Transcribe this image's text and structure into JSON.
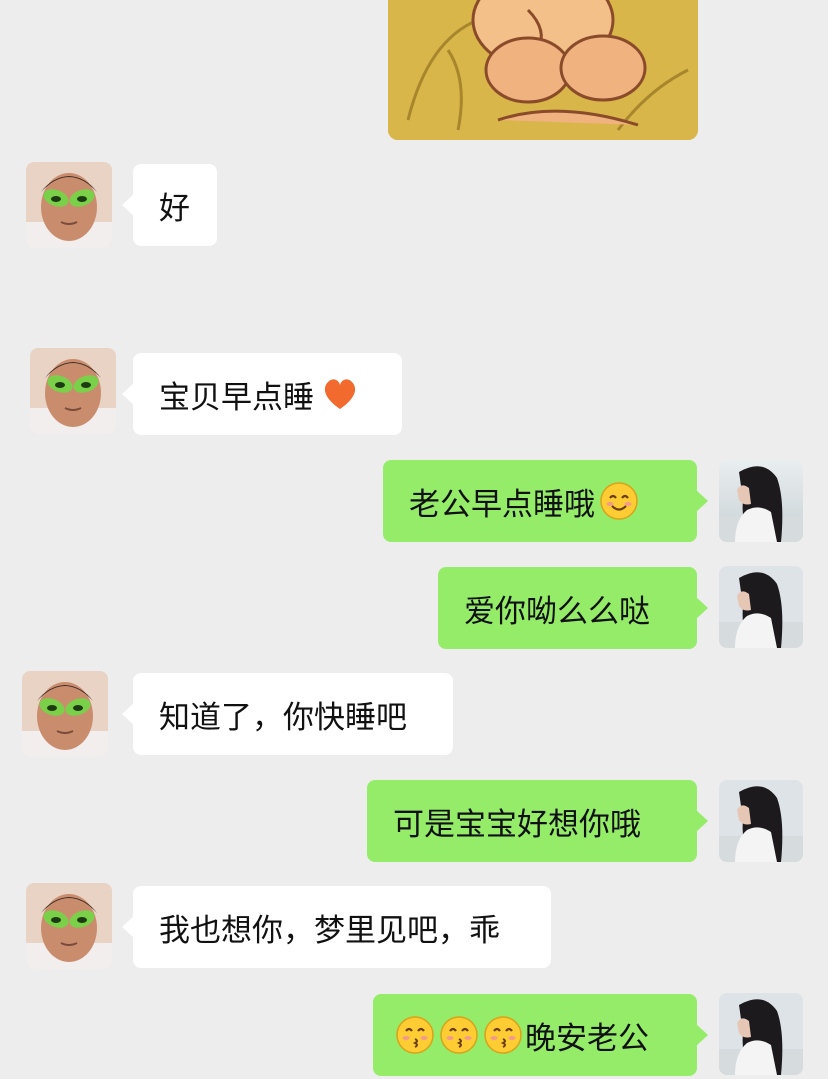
{
  "chat": {
    "messages": [
      {
        "side": "left",
        "text": "好"
      },
      {
        "side": "left",
        "text": "宝贝早点睡",
        "emoji_after": "orange-heart"
      },
      {
        "side": "right",
        "text": "老公早点睡哦",
        "emoji_after": "smiling-face"
      },
      {
        "side": "right",
        "text": "爱你呦么么哒"
      },
      {
        "side": "left",
        "text": "知道了，你快睡吧"
      },
      {
        "side": "right",
        "text": "可是宝宝好想你哦"
      },
      {
        "side": "left",
        "text": "我也想你，梦里见吧，乖"
      },
      {
        "side": "right",
        "emoji_before": [
          "kissing-face",
          "kissing-face",
          "kissing-face"
        ],
        "text": "晚安老公"
      }
    ]
  },
  "icons": {
    "left_avatar": "man-with-alien-sunglasses-avatar",
    "right_avatar": "girl-avatar",
    "top_sticker": "cartoon-sticker"
  },
  "colors": {
    "background": "#ededed",
    "incoming_bubble": "#ffffff",
    "outgoing_bubble": "#95ec69"
  }
}
